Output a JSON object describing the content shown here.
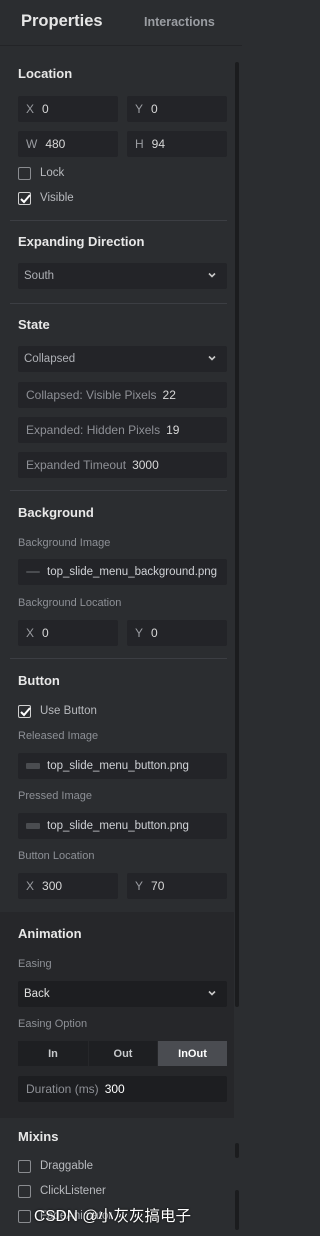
{
  "tabs": {
    "properties": "Properties",
    "interactions": "Interactions"
  },
  "location": {
    "title": "Location",
    "x_label": "X",
    "x_value": "0",
    "y_label": "Y",
    "y_value": "0",
    "w_label": "W",
    "w_value": "480",
    "h_label": "H",
    "h_value": "94",
    "lock_label": "Lock",
    "lock_checked": false,
    "visible_label": "Visible",
    "visible_checked": true
  },
  "expanding_direction": {
    "title": "Expanding Direction",
    "selected": "South"
  },
  "state": {
    "title": "State",
    "selected": "Collapsed",
    "collapsed_visible_label": "Collapsed: Visible Pixels",
    "collapsed_visible_value": "22",
    "expanded_hidden_label": "Expanded: Hidden Pixels",
    "expanded_hidden_value": "19",
    "expanded_timeout_label": "Expanded Timeout",
    "expanded_timeout_value": "3000"
  },
  "background": {
    "title": "Background",
    "image_label": "Background Image",
    "image_file": "top_slide_menu_background.png",
    "location_label": "Background Location",
    "x_label": "X",
    "x_value": "0",
    "y_label": "Y",
    "y_value": "0"
  },
  "button": {
    "title": "Button",
    "use_button_label": "Use Button",
    "use_button_checked": true,
    "released_label": "Released Image",
    "released_file": "top_slide_menu_button.png",
    "pressed_label": "Pressed Image",
    "pressed_file": "top_slide_menu_button.png",
    "location_label": "Button Location",
    "x_label": "X",
    "x_value": "300",
    "y_label": "Y",
    "y_value": "70"
  },
  "animation": {
    "title": "Animation",
    "easing_label": "Easing",
    "easing_selected": "Back",
    "easing_option_label": "Easing Option",
    "options": [
      "In",
      "Out",
      "InOut"
    ],
    "active_option": "InOut",
    "duration_label": "Duration (ms)",
    "duration_value": "300"
  },
  "mixins": {
    "title": "Mixins",
    "items": [
      "Draggable",
      "ClickListener",
      "FadeAnimator"
    ]
  },
  "watermark": "CSDN @小灰灰搞电子",
  "colors": {
    "panel": "#2b2d30",
    "field": "#232428",
    "active_segment": "#4a4c51"
  }
}
